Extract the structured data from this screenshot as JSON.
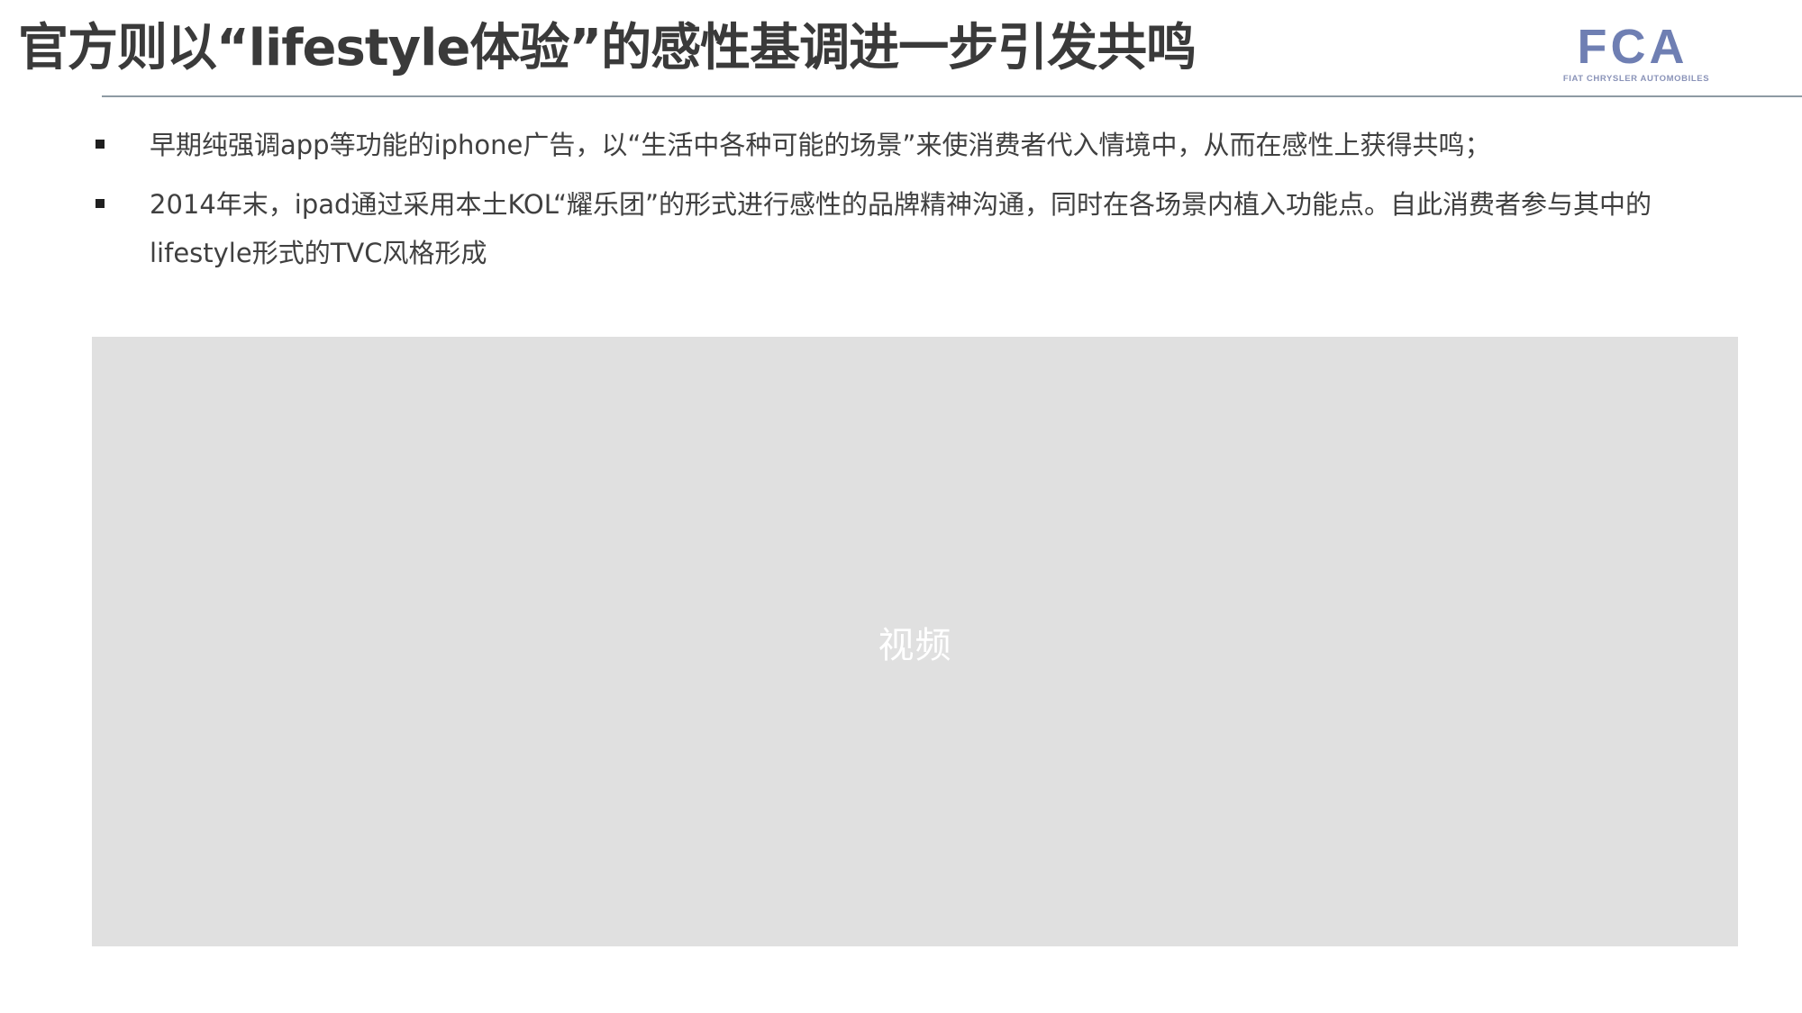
{
  "slide": {
    "title": "官方则以“lifestyle体验”的感性基调进一步引发共鸣"
  },
  "logo": {
    "wordmark": "FCA",
    "subtitle": "FIAT CHRYSLER AUTOMOBILES",
    "color": "#6f7fb3",
    "subtitle_color": "#8a93b8"
  },
  "bullets": [
    {
      "text": "早期纯强调app等功能的iphone广告，以“生活中各种可能的场景”来使消费者代入情境中，从而在感性上获得共鸣；"
    },
    {
      "text": "2014年末，ipad通过采用本土KOL“耀乐团”的形式进行感性的品牌精神沟通，同时在各场景内植入功能点。自此消费者参与其中的lifestyle形式的TVC风格形成"
    }
  ],
  "video": {
    "label": "视频",
    "background_color": "#e0e0e0"
  },
  "colors": {
    "title": "#3a3a3a",
    "body_text": "#404040",
    "rule": "#8e9aa3"
  }
}
